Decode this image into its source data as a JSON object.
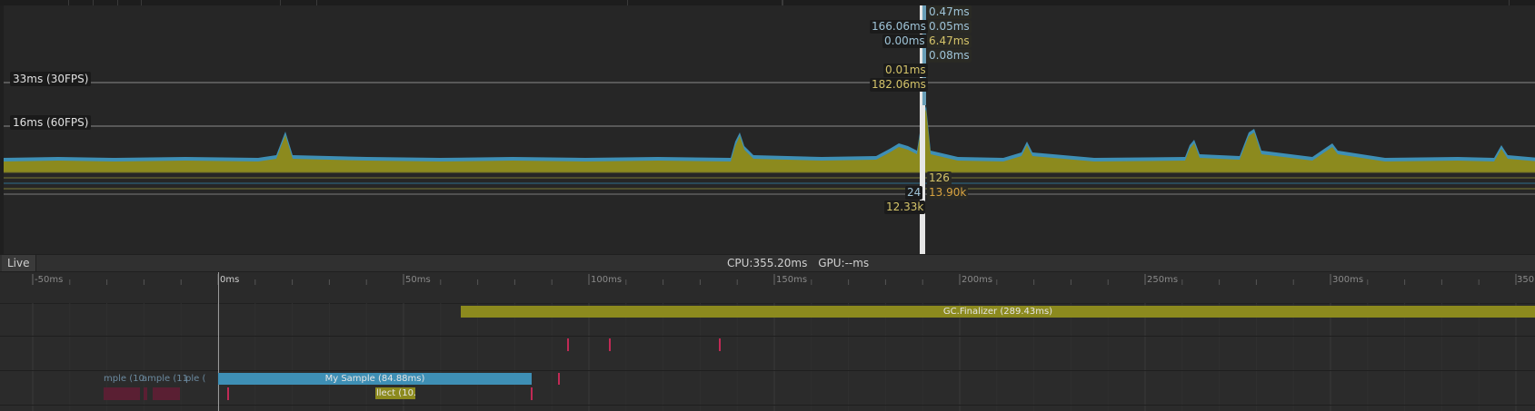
{
  "thresholds": {
    "fps30": "33ms (30FPS)",
    "fps60": "16ms (60FPS)"
  },
  "cursor_values": {
    "right_top": [
      "0.47ms",
      "0.05ms",
      "6.47ms",
      "0.08ms"
    ],
    "left_top": [
      "166.06ms",
      "0.00ms"
    ],
    "mid": [
      "0.01ms",
      "182.06ms"
    ],
    "lower_right": [
      "126",
      "13.90k"
    ],
    "lower_left": [
      "24",
      "12.33k"
    ]
  },
  "status": {
    "tab": "Live",
    "cpu": "CPU:355.20ms",
    "gpu": "GPU:--ms"
  },
  "ruler": {
    "labels": [
      "-50ms",
      "0ms",
      "50ms",
      "100ms",
      "150ms",
      "200ms",
      "250ms",
      "300ms",
      "350"
    ]
  },
  "tracks": {
    "gc_finalizer": "GC.Finalizer (289.43ms)",
    "my_sample": "My Sample (84.88ms)",
    "ghost1": "mple (10.",
    "ghost2": "ample (11.5",
    "ghost3": "ple (",
    "collect": "llect (10."
  },
  "colors": {
    "olive": "#8c8a1e",
    "teal": "#3e8fb5",
    "crimson": "#c02a55",
    "cursor": "#e6e6e6"
  }
}
